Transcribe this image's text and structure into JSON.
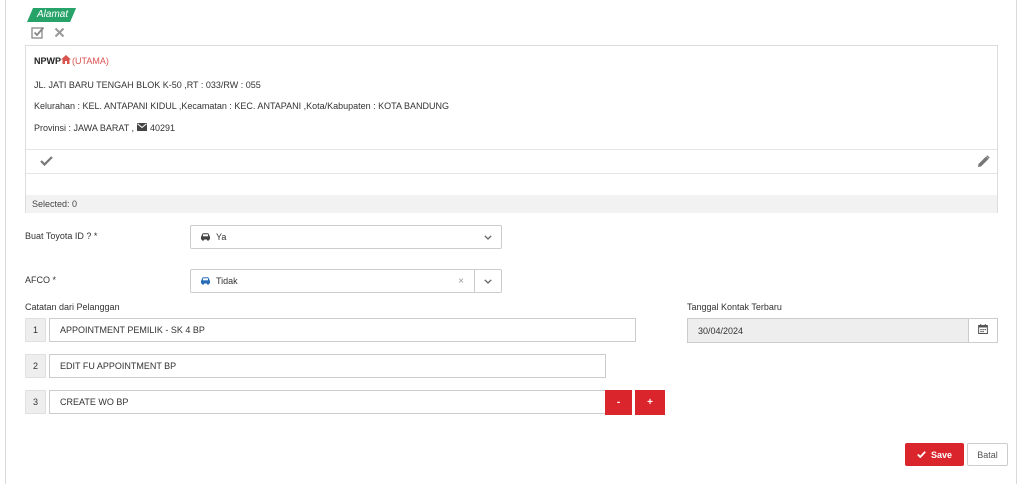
{
  "colors": {
    "accent_green": "#27a36a",
    "danger_red": "#d9252b",
    "home_red": "#d9534f",
    "car_blue": "#2a6fb5"
  },
  "address": {
    "tag_label": "Alamat",
    "npwp_label": "NPWP",
    "primary_label": "(UTAMA)",
    "line1": "JL. JATI BARU TENGAH BLOK K-50 ,RT : 033/RW : 055",
    "line2": "Kelurahan : KEL. ANTAPANI KIDUL ,Kecamatan : KEC. ANTAPANI ,Kota/Kabupaten : KOTA BANDUNG",
    "line3_prefix": "Provinsi : JAWA BARAT ,",
    "postal_code": "40291",
    "selected_text": "Selected: 0",
    "icons": {
      "confirm": "check-square-icon",
      "cancel": "close-icon",
      "home": "home-icon",
      "mail": "envelope-icon",
      "row_check": "check-icon",
      "edit": "pencil-icon"
    }
  },
  "form": {
    "toyota_id": {
      "label": "Buat Toyota ID ? *",
      "value": "Ya",
      "icon": "car-icon"
    },
    "afco": {
      "label": "AFCO *",
      "value": "Tidak",
      "clear": "×",
      "icon": "car-icon"
    },
    "notes": {
      "label": "Catatan dari Pelanggan",
      "items": [
        {
          "num": "1",
          "value": "APPOINTMENT PEMILIK - SK 4 BP"
        },
        {
          "num": "2",
          "value": "EDIT FU APPOINTMENT BP"
        },
        {
          "num": "3",
          "value": "CREATE WO BP"
        }
      ],
      "remove_label": "-",
      "add_label": "+"
    },
    "last_contact": {
      "label": "Tanggal Kontak Terbaru",
      "value": "30/04/2024",
      "icon": "calendar-icon"
    }
  },
  "actions": {
    "save_label": "Save",
    "cancel_label": "Batal"
  }
}
